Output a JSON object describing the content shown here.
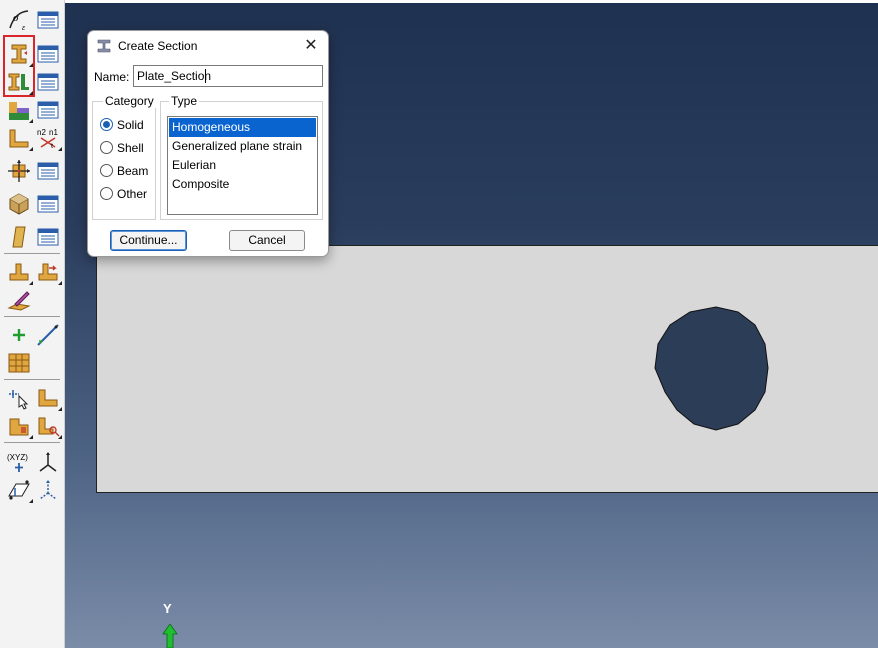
{
  "dialog": {
    "title": "Create Section",
    "close_symbol": "✕",
    "name_label": "Name:",
    "name_value": "Plate_Section",
    "category_label": "Category",
    "type_label": "Type",
    "categories": [
      {
        "label": "Solid",
        "selected": true
      },
      {
        "label": "Shell",
        "selected": false
      },
      {
        "label": "Beam",
        "selected": false
      },
      {
        "label": "Other",
        "selected": false
      }
    ],
    "types": [
      {
        "label": "Homogeneous",
        "selected": true
      },
      {
        "label": "Generalized plane strain",
        "selected": false
      },
      {
        "label": "Eulerian",
        "selected": false
      },
      {
        "label": "Composite",
        "selected": false
      }
    ],
    "continue_label": "Continue...",
    "cancel_label": "Cancel"
  },
  "viewport": {
    "axis_label": "Y",
    "background_top": "#1f3150",
    "background_bottom": "#7b8ca8",
    "plate_color": "#d8d8d8",
    "hole_color": "#2c3d57"
  },
  "toolbox": {
    "highlight_color": "#d9262c",
    "tools": [
      "material-create-icon",
      "material-manager-icon",
      "section-create-icon",
      "section-manager-icon",
      "section-assign-icon",
      "section-assignment-manager-icon",
      "profile-create-icon",
      "profile-manager-icon",
      "beam-orientation-icon",
      "normal-flip-icon",
      "material-orientation-icon",
      "orientation-manager-icon",
      "solid-part-icon",
      "part-manager-icon",
      "shell-part-icon",
      "shell-manager-icon",
      "skin-create-icon",
      "stringer-create-icon",
      "composite-layup-icon",
      "datum-point-icon",
      "datum-axis-icon",
      "partition-grid-icon",
      "query-pick-icon",
      "edge-tool-icon",
      "face-tool-icon",
      "cell-tool-icon",
      "coordinate-xyz-icon",
      "csys-create-icon",
      "csys-plane-icon",
      "csys-transform-icon"
    ]
  }
}
